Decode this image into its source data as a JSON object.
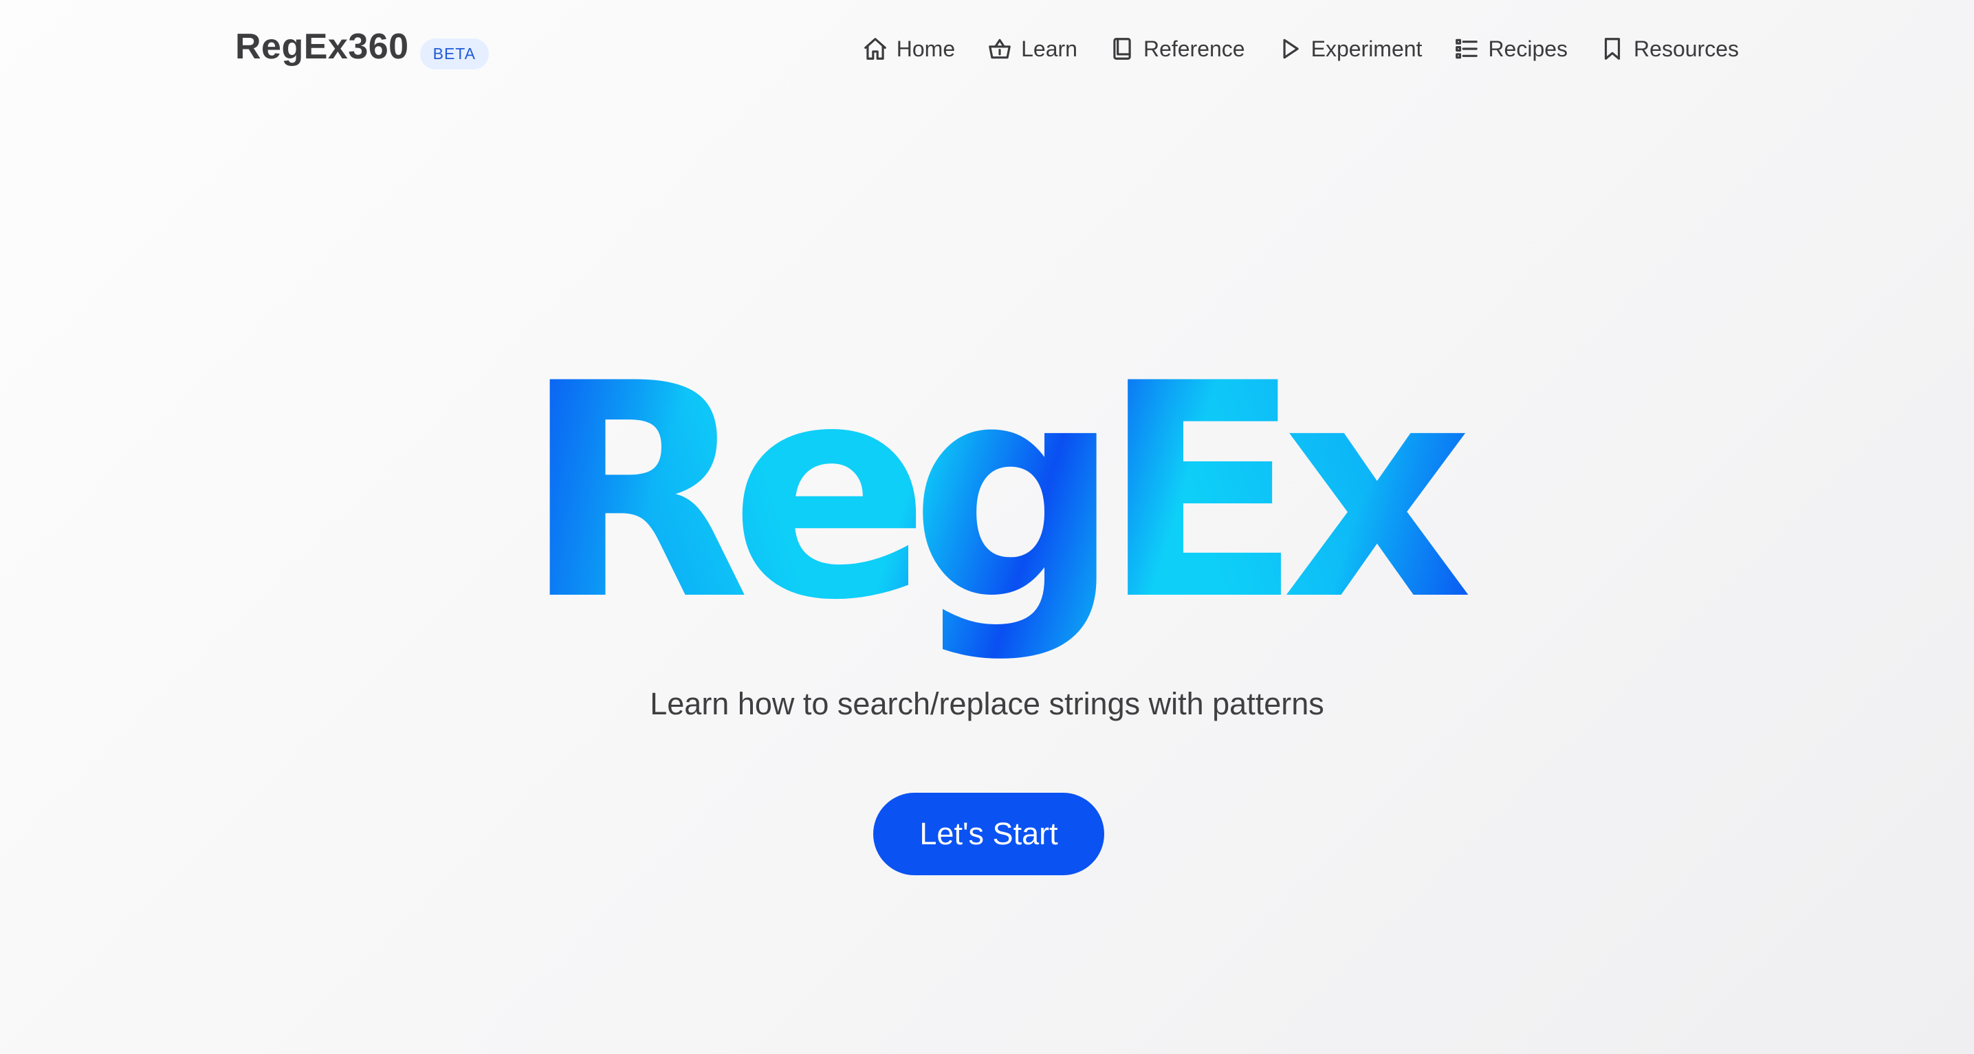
{
  "header": {
    "brand": "RegEx360",
    "badge": "BETA",
    "nav": [
      {
        "label": "Home",
        "icon": "home-icon"
      },
      {
        "label": "Learn",
        "icon": "basket-icon"
      },
      {
        "label": "Reference",
        "icon": "book-icon"
      },
      {
        "label": "Experiment",
        "icon": "play-icon"
      },
      {
        "label": "Recipes",
        "icon": "list-icon"
      },
      {
        "label": "Resources",
        "icon": "bookmark-icon"
      }
    ]
  },
  "hero": {
    "logo_text": "RegEx",
    "tagline": "Learn how to search/replace strings with patterns",
    "cta_label": "Let's Start"
  },
  "colors": {
    "accent": "#0a52f2",
    "logo_light": "#0ecff8",
    "logo_dark": "#0a4ff2",
    "badge_bg": "#e6efff",
    "badge_text": "#1f5bd6"
  }
}
